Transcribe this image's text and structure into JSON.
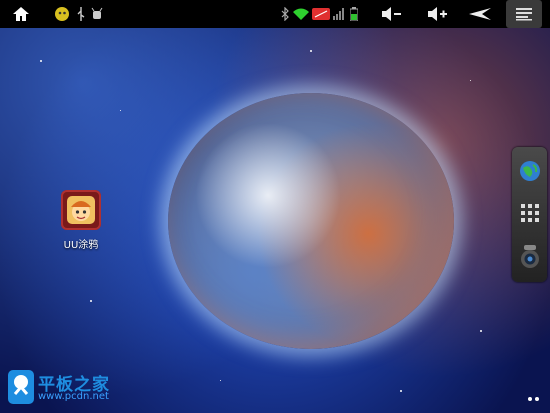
{
  "status_bar": {
    "home_icon": "home-icon",
    "notification_icons": [
      "app-notification-icon",
      "usb-icon",
      "android-debug-icon"
    ],
    "system_icons": [
      "bluetooth-icon",
      "wifi-icon",
      "signal-icon",
      "battery-icon"
    ],
    "buttons": [
      "volume-down-icon",
      "volume-up-icon",
      "back-icon",
      "menu-icon"
    ]
  },
  "desktop": {
    "apps": [
      {
        "label": "UU涂鸦",
        "icon": "uu-doodle-app-icon"
      }
    ]
  },
  "dock": {
    "items": [
      "browser-globe-icon",
      "app-drawer-grid-icon",
      "camera-icon"
    ]
  },
  "watermark": {
    "title": "平板之家",
    "url": "www.pcdn.net"
  },
  "colors": {
    "statusbar_bg": "#000000",
    "wifi_green": "#2ed02e",
    "signal_red": "#e03030",
    "battery_green": "#30c030",
    "watermark_blue": "#1e8de0"
  }
}
